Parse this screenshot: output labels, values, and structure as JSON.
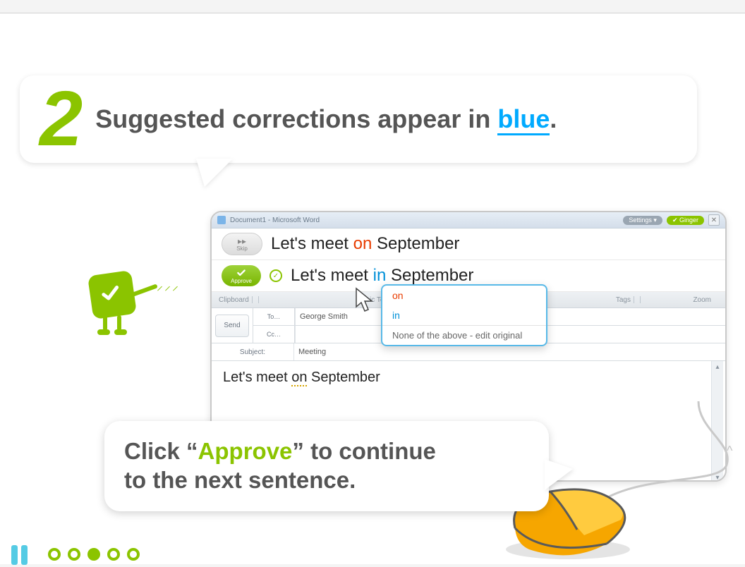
{
  "step_number": "2",
  "bubble1": {
    "prefix": "Suggested corrections appear in ",
    "highlight": "blue",
    "suffix": "."
  },
  "bubble2": {
    "line_prefix": "Click “",
    "approve_word": "Approve",
    "line_mid": "” to continue",
    "line2": "to the next sentence."
  },
  "monitor": {
    "titlebar": {
      "doc_title": "Document1 - Microsoft Word",
      "settings_label": "Settings ▾",
      "ginger_label": "✔ Ginger",
      "close_glyph": "✕"
    },
    "skip_label": "Skip",
    "approve_label": "Approve",
    "original": {
      "pre": "Let's meet ",
      "error": "on",
      "post": " September"
    },
    "corrected": {
      "pre": "Let's meet ",
      "fix": "in",
      "post": " September"
    },
    "ribbon": {
      "clipboard": "Clipboard",
      "basic_text": "Basic Text",
      "tags": "Tags",
      "zoom": "Zoom"
    },
    "compose": {
      "send": "Send",
      "to_label": "To…",
      "cc_label": "Cc…",
      "to_value": "George Smith",
      "cc_value": "",
      "subject_label": "Subject:",
      "subject_value": "Meeting"
    },
    "body": {
      "pre": "Let's meet ",
      "marked": "on",
      "post": " September"
    }
  },
  "popup": {
    "opt1": "on",
    "opt2": "in",
    "opt3": "None of the above - edit original"
  },
  "caret_glyph": "^",
  "pagination": {
    "total": 5,
    "active_index": 2
  }
}
